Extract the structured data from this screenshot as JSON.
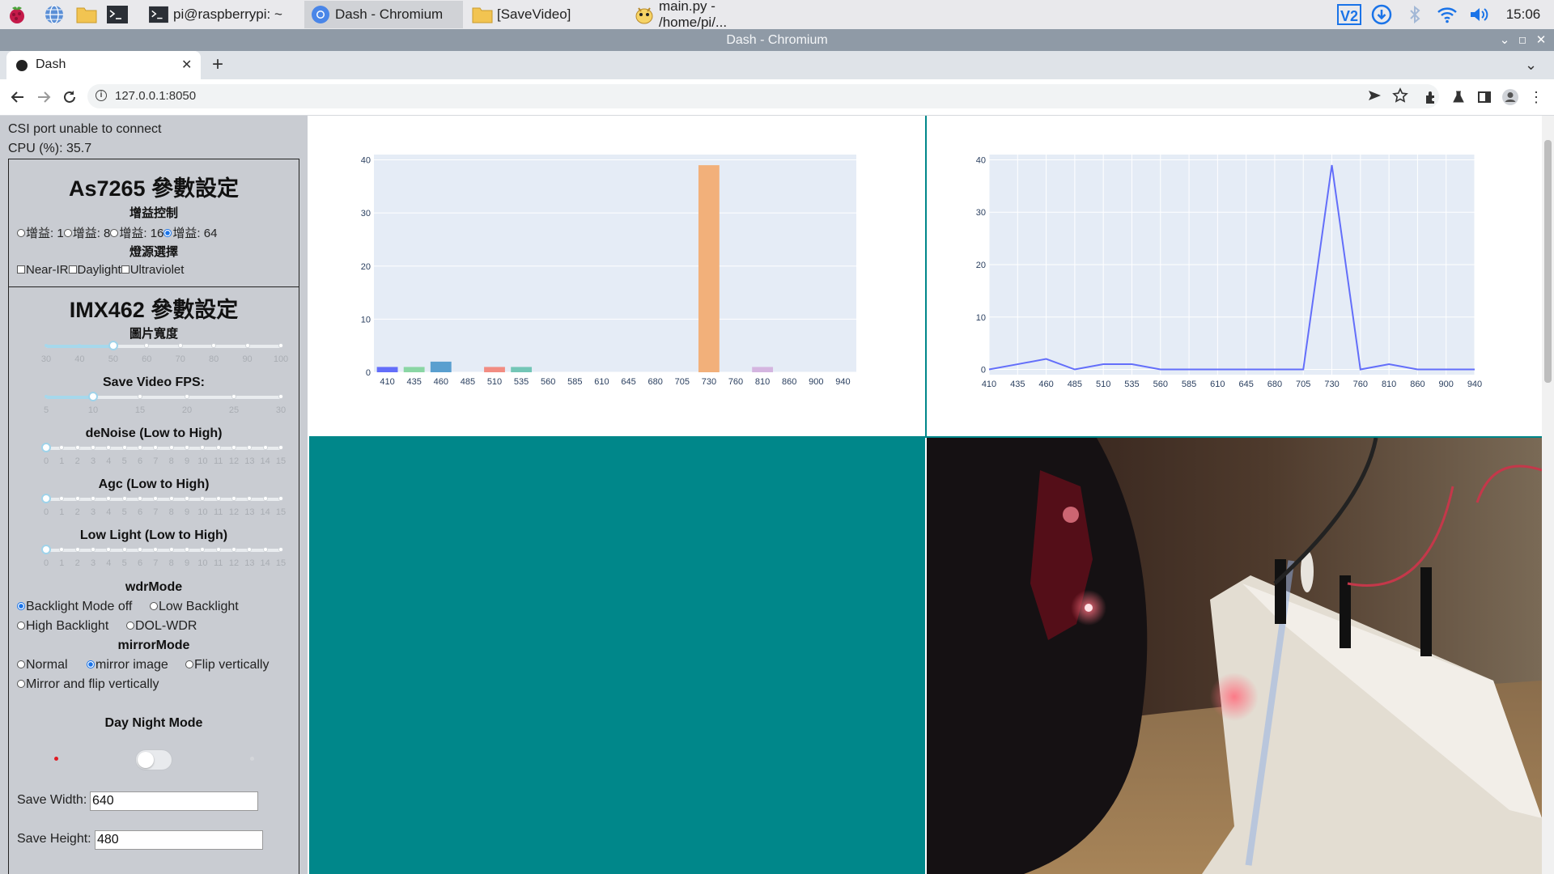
{
  "taskbar": {
    "tasks": [
      {
        "label": "pi@raspberrypi: ~"
      },
      {
        "label": "Dash - Chromium"
      },
      {
        "label": "[SaveVideo]"
      },
      {
        "label": "main.py - /home/pi/..."
      }
    ],
    "tray": {
      "time": "15:06",
      "vnc_label": "V2"
    }
  },
  "window": {
    "title": "Dash - Chromium"
  },
  "browser": {
    "tab_title": "Dash",
    "url": "127.0.0.1:8050"
  },
  "status": {
    "csi": "CSI port unable to connect",
    "cpu": "CPU (%): 35.7"
  },
  "as7265": {
    "title": "As7265 參數設定",
    "gain_title": "增益控制",
    "gains": [
      "增益: 1",
      "增益: 8",
      "增益: 16",
      "增益: 64"
    ],
    "gain_selected": "增益: 64",
    "light_title": "燈源選擇",
    "lights": [
      "Near-IR",
      "Daylight",
      "Ultraviolet"
    ]
  },
  "imx462": {
    "title": "IMX462 參數設定",
    "width_title": "圖片寬度",
    "width_slider": {
      "min": 30,
      "max": 100,
      "value": 50,
      "ticks": [
        "30",
        "40",
        "50",
        "60",
        "70",
        "80",
        "90",
        "100"
      ]
    },
    "fps_title": "Save Video FPS:",
    "fps_slider": {
      "min": 5,
      "max": 30,
      "value": 10,
      "ticks": [
        "5",
        "10",
        "15",
        "20",
        "25",
        "30"
      ]
    },
    "denoise_title": "deNoise (Low to High)",
    "agc_title": "Agc (Low to High)",
    "lowlight_title": "Low Light (Low to High)",
    "level_ticks": [
      "0",
      "1",
      "2",
      "3",
      "4",
      "5",
      "6",
      "7",
      "8",
      "9",
      "10",
      "11",
      "12",
      "13",
      "14",
      "15"
    ],
    "denoise_value": 0,
    "agc_value": 0,
    "lowlight_value": 0,
    "wdr_title": "wdrMode",
    "wdr_options": [
      "Backlight Mode off",
      "Low Backlight",
      "High Backlight",
      "DOL-WDR"
    ],
    "wdr_selected": "Backlight Mode off",
    "mirror_title": "mirrorMode",
    "mirror_options": [
      "Normal",
      "mirror image",
      "Flip vertically",
      "Mirror and flip vertically"
    ],
    "mirror_selected": "mirror image",
    "daynight_title": "Day Night Mode",
    "daynight_on": false,
    "save_width_label": "Save Width:",
    "save_width_value": "640",
    "save_height_label": "Save Height:",
    "save_height_value": "480"
  },
  "chart_data": [
    {
      "type": "bar",
      "categories": [
        "410",
        "435",
        "460",
        "485",
        "510",
        "535",
        "560",
        "585",
        "610",
        "645",
        "680",
        "705",
        "730",
        "760",
        "810",
        "860",
        "900",
        "940"
      ],
      "values": [
        1,
        1,
        2,
        0,
        1,
        1,
        0,
        0,
        0,
        0,
        0,
        0,
        39,
        0,
        1,
        0,
        0,
        0
      ],
      "bar_colors": [
        "#636efa",
        "#8ad6a4",
        "#5a9fcf",
        "#ab63fa",
        "#f28c82",
        "#73c6b6",
        "#ffa15a",
        "#19d3f3",
        "#ff6692",
        "#b6e880",
        "#ff97ff",
        "#fecb52",
        "#f2b07a",
        "#636efa",
        "#d4b5e0",
        "#00cc96",
        "#ab63fa",
        "#ffa15a"
      ],
      "ylim": [
        0,
        41
      ],
      "yticks": [
        "0",
        "10",
        "20",
        "30",
        "40"
      ],
      "xlabel": "",
      "ylabel": ""
    },
    {
      "type": "line",
      "x": [
        "410",
        "435",
        "460",
        "485",
        "510",
        "535",
        "560",
        "585",
        "610",
        "645",
        "680",
        "705",
        "730",
        "760",
        "810",
        "860",
        "900",
        "940"
      ],
      "y": [
        0,
        1,
        2,
        0,
        1,
        1,
        0,
        0,
        0,
        0,
        0,
        0,
        39,
        0,
        1,
        0,
        0,
        0
      ],
      "color": "#636efa",
      "ylim": [
        -1,
        41
      ],
      "yticks": [
        "0",
        "10",
        "20",
        "30",
        "40"
      ],
      "xlabel": "",
      "ylabel": ""
    }
  ]
}
